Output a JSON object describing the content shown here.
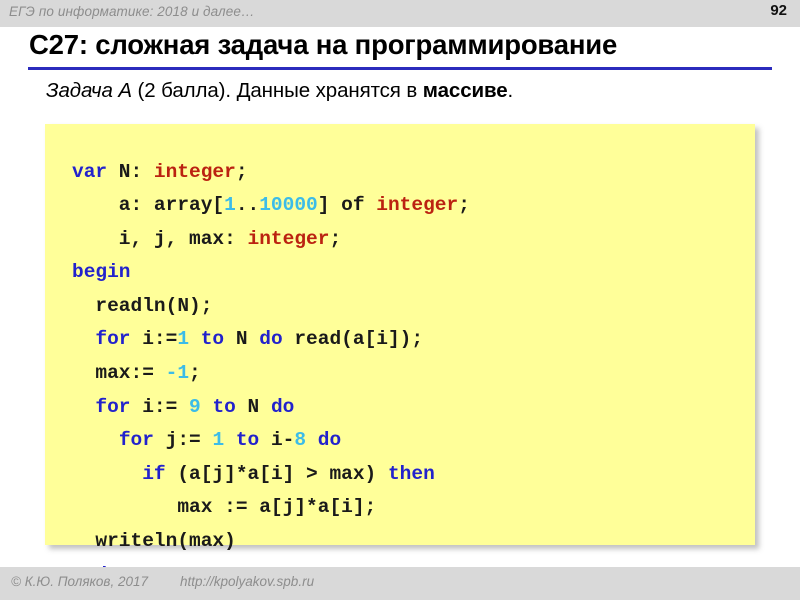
{
  "header": {
    "course_title": "ЕГЭ по информатике: 2018 и далее…",
    "slide_number": "92"
  },
  "slide": {
    "title": "C27: сложная задача на программирование",
    "subtitle": {
      "task_label": "Задача A",
      "points": " (2 балла). Данные хранятся в ",
      "emphasis": "массиве",
      "tail": "."
    }
  },
  "code": {
    "language": "pascal",
    "colors": {
      "background": "#ffff99",
      "keyword": "#2222cc",
      "type": "#bb2211",
      "number": "#3cbce8",
      "plain": "#1a1a1a"
    },
    "lines": [
      [
        {
          "t": "var",
          "c": "kw"
        },
        {
          "t": " N: ",
          "c": "pl"
        },
        {
          "t": "integer",
          "c": "ty"
        },
        {
          "t": ";",
          "c": "pl"
        }
      ],
      [
        {
          "t": "    a: array[",
          "c": "pl"
        },
        {
          "t": "1",
          "c": "num"
        },
        {
          "t": "..",
          "c": "pl"
        },
        {
          "t": "10000",
          "c": "num"
        },
        {
          "t": "] of ",
          "c": "pl"
        },
        {
          "t": "integer",
          "c": "ty"
        },
        {
          "t": ";",
          "c": "pl"
        }
      ],
      [
        {
          "t": "    i, j, max: ",
          "c": "pl"
        },
        {
          "t": "integer",
          "c": "ty"
        },
        {
          "t": ";",
          "c": "pl"
        }
      ],
      [
        {
          "t": "begin",
          "c": "kw"
        }
      ],
      [
        {
          "t": "  readln(N);",
          "c": "pl"
        }
      ],
      [
        {
          "t": "  ",
          "c": "pl"
        },
        {
          "t": "for",
          "c": "kw"
        },
        {
          "t": " i:=",
          "c": "pl"
        },
        {
          "t": "1",
          "c": "num"
        },
        {
          "t": " ",
          "c": "pl"
        },
        {
          "t": "to",
          "c": "kw"
        },
        {
          "t": " N ",
          "c": "pl"
        },
        {
          "t": "do",
          "c": "kw"
        },
        {
          "t": " read(a[i]);",
          "c": "pl"
        }
      ],
      [
        {
          "t": "  max:= ",
          "c": "pl"
        },
        {
          "t": "-1",
          "c": "num"
        },
        {
          "t": ";",
          "c": "pl"
        }
      ],
      [
        {
          "t": "  ",
          "c": "pl"
        },
        {
          "t": "for",
          "c": "kw"
        },
        {
          "t": " i:= ",
          "c": "pl"
        },
        {
          "t": "9",
          "c": "num"
        },
        {
          "t": " ",
          "c": "pl"
        },
        {
          "t": "to",
          "c": "kw"
        },
        {
          "t": " N ",
          "c": "pl"
        },
        {
          "t": "do",
          "c": "kw"
        }
      ],
      [
        {
          "t": "    ",
          "c": "pl"
        },
        {
          "t": "for",
          "c": "kw"
        },
        {
          "t": " j:= ",
          "c": "pl"
        },
        {
          "t": "1",
          "c": "num"
        },
        {
          "t": " ",
          "c": "pl"
        },
        {
          "t": "to",
          "c": "kw"
        },
        {
          "t": " i-",
          "c": "pl"
        },
        {
          "t": "8",
          "c": "num"
        },
        {
          "t": " ",
          "c": "pl"
        },
        {
          "t": "do",
          "c": "kw"
        }
      ],
      [
        {
          "t": "      ",
          "c": "pl"
        },
        {
          "t": "if",
          "c": "kw"
        },
        {
          "t": " (a[j]*a[i] > max) ",
          "c": "pl"
        },
        {
          "t": "then",
          "c": "kw"
        }
      ],
      [
        {
          "t": "         max := a[j]*a[i];",
          "c": "pl"
        }
      ],
      [
        {
          "t": "  writeln(max)",
          "c": "pl"
        }
      ],
      [
        {
          "t": "end",
          "c": "kw"
        },
        {
          "t": ".",
          "c": "pl"
        }
      ]
    ]
  },
  "footer": {
    "copyright": "© К.Ю. Поляков, 2017",
    "url": "http://kpolyakov.spb.ru"
  }
}
